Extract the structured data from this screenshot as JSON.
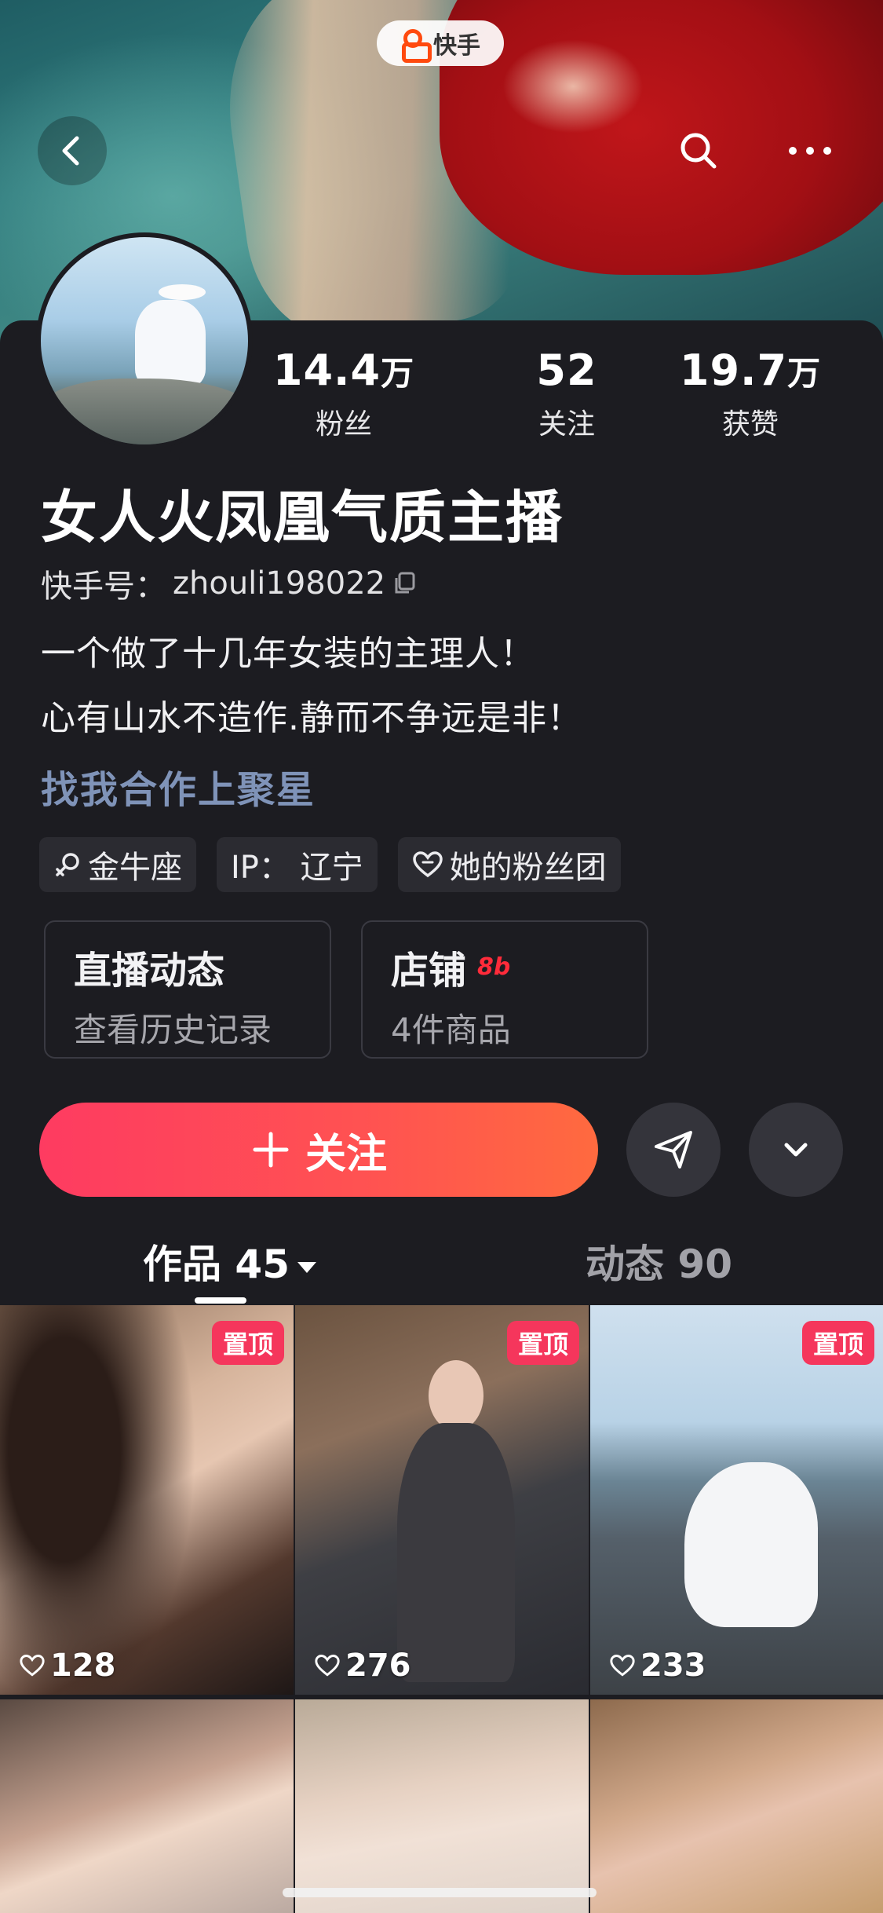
{
  "app": {
    "name": "快手"
  },
  "profile": {
    "name": "女人火凤凰气质主播",
    "kuaishou_id_label": "快手号：",
    "kuaishou_id": "zhouli198022",
    "bio": [
      "一个做了十几年女装的主理人！",
      "心有山水不造作.静而不争远是非！"
    ],
    "cooperation_link": "找我合作上聚星"
  },
  "stats": [
    {
      "num": "14.4",
      "unit": "万",
      "label": "粉丝"
    },
    {
      "num": "52",
      "unit": "",
      "label": "关注"
    },
    {
      "num": "19.7",
      "unit": "万",
      "label": "获赞"
    }
  ],
  "tags": [
    "金牛座",
    "IP：  辽宁",
    "她的粉丝团"
  ],
  "cards": [
    {
      "title": "直播动态",
      "subtitle": "查看历史记录"
    },
    {
      "title": "店铺",
      "badge": "8b",
      "subtitle": "4件商品"
    }
  ],
  "actions": {
    "follow_label": "关注"
  },
  "tabs": {
    "works": "作品 45",
    "moments": "动态 90"
  },
  "videos": [
    {
      "pinned": "置顶",
      "likes": "128"
    },
    {
      "pinned": "置顶",
      "likes": "276"
    },
    {
      "pinned": "置顶",
      "likes": "233"
    },
    {
      "pinned": "",
      "likes": ""
    },
    {
      "pinned": "",
      "likes": ""
    },
    {
      "pinned": "",
      "likes": ""
    }
  ],
  "icons": [
    "back-icon",
    "search-icon",
    "more-icon",
    "copy-icon",
    "constellation-icon",
    "heart-outline-icon",
    "plus-icon",
    "share-icon",
    "chevron-down-icon"
  ],
  "colors": {
    "accent": "#fe3b61",
    "pin": "#f5365c",
    "link": "#7f93b8",
    "background": "#1c1c21"
  }
}
